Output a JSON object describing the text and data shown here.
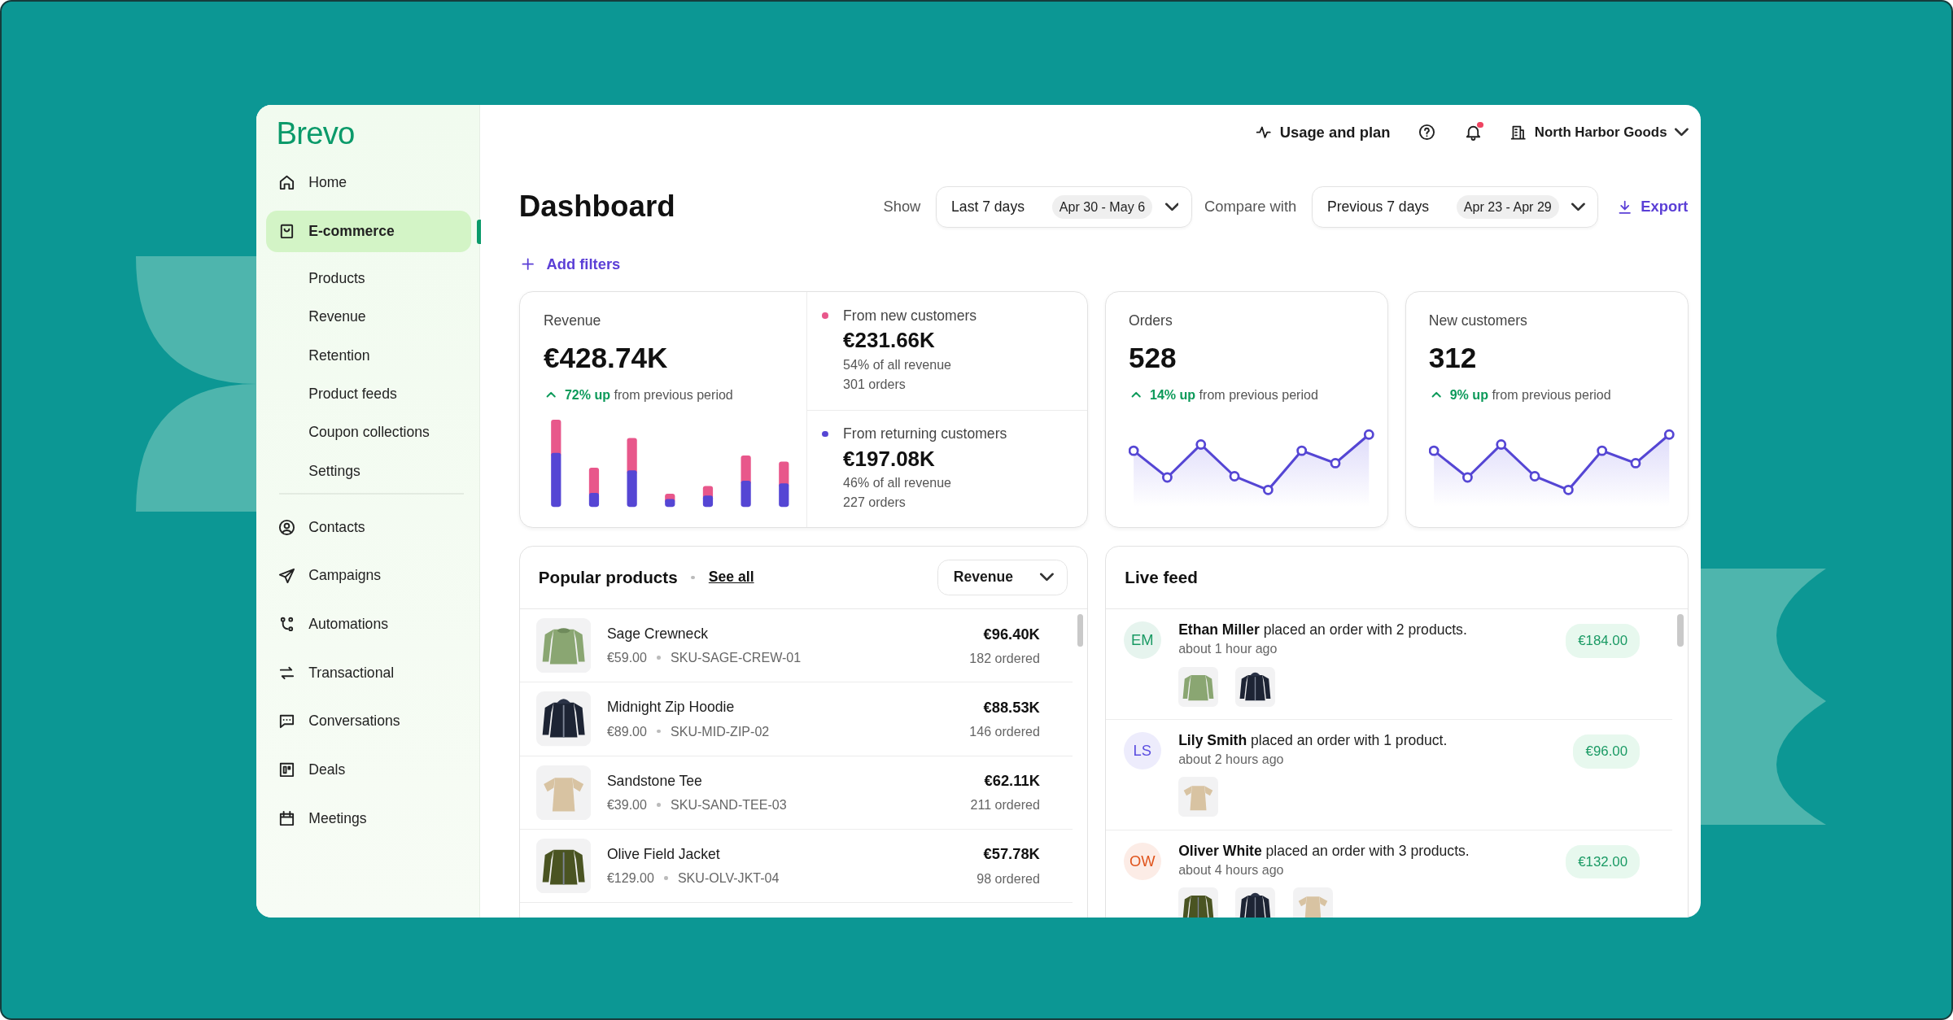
{
  "sidebar": {
    "logo": "Brevo",
    "items": [
      {
        "label": "Home",
        "selected": false
      },
      {
        "label": "E-commerce",
        "selected": true,
        "children": [
          {
            "label": "Products",
            "selected": false
          },
          {
            "label": "Revenue",
            "selected": false
          },
          {
            "label": "Retention",
            "selected": false
          },
          {
            "label": "Product feeds",
            "selected": false
          },
          {
            "label": "Coupon collections",
            "selected": false
          },
          {
            "label": "Settings",
            "selected": false
          }
        ]
      },
      {
        "label": "Contacts",
        "selected": false
      },
      {
        "label": "Campaigns",
        "selected": false
      },
      {
        "label": "Automations",
        "selected": false
      },
      {
        "label": "Transactional",
        "selected": false
      },
      {
        "label": "Conversations",
        "selected": false
      },
      {
        "label": "Deals",
        "selected": false
      },
      {
        "label": "Meetings",
        "selected": false
      }
    ]
  },
  "header": {
    "usage": "Usage and plan",
    "unread_notifications": true,
    "workspace": "North Harbor Goods"
  },
  "toolbar": {
    "title": "Dashboard",
    "show_label": "Show",
    "period": {
      "value": "Last 7 days",
      "range": "Apr 30 - May 6"
    },
    "compare_label": "Compare with",
    "compare": {
      "value": "Previous 7 days",
      "range": "Apr 23 - Apr 29"
    },
    "export": "Export",
    "add_filters": "Add filters"
  },
  "revenue": {
    "label": "Revenue",
    "value": "€428.74K",
    "change": "**72% up** from previous period",
    "breakdown": [
      {
        "label": "From new customers",
        "color": "#e8578b",
        "value": "€231.66K",
        "share": "54% of all revenue",
        "orders": "301 orders"
      },
      {
        "label": "From returning customers",
        "color": "#5546d4",
        "value": "€197.08K",
        "share": "46% of all revenue",
        "orders": "227 orders"
      }
    ]
  },
  "metrics": [
    {
      "label": "Orders",
      "value": "528",
      "change": "**14% up** from previous period"
    },
    {
      "label": "New customers",
      "value": "312",
      "change": "**9% up** from previous period"
    }
  ],
  "popular_products": {
    "title": "Popular products",
    "see_all": "See all",
    "sort": "Revenue",
    "rows": [
      {
        "name": "Sage Crewneck",
        "price": "€59.00",
        "sku": "SKU-SAGE-CREW-01",
        "revenue": "€96.40K",
        "ordered": "182 ordered"
      },
      {
        "name": "Midnight Zip Hoodie",
        "price": "€89.00",
        "sku": "SKU-MID-ZIP-02",
        "revenue": "€88.53K",
        "ordered": "146 ordered"
      },
      {
        "name": "Sandstone Tee",
        "price": "€39.00",
        "sku": "SKU-SAND-TEE-03",
        "revenue": "€62.11K",
        "ordered": "211 ordered"
      },
      {
        "name": "Olive Field Jacket",
        "price": "€129.00",
        "sku": "SKU-OLV-JKT-04",
        "revenue": "€57.78K",
        "ordered": "98 ordered"
      }
    ]
  },
  "live_feed": {
    "title": "Live feed",
    "items": [
      {
        "initials": "EM",
        "color": "#1a9a64",
        "message": "**Ethan Miller** placed an order with 2 products.",
        "time": "about 1 hour ago",
        "amount": "€184.00"
      },
      {
        "initials": "LS",
        "color": "#5b4ee0",
        "message": "**Lily Smith** placed an order with 1 product.",
        "time": "about 2 hours ago",
        "amount": "€96.00"
      },
      {
        "initials": "OW",
        "color": "#e0541c",
        "message": "**Oliver White** placed an order with 3 products.",
        "time": "about 4 hours ago",
        "amount": "€132.00"
      }
    ]
  }
}
